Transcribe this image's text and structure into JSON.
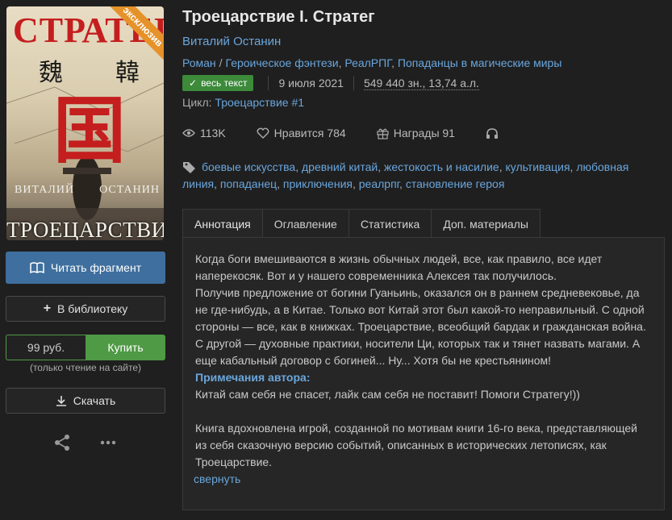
{
  "cover": {
    "title_top": "СТРАТЕГ",
    "badge": "эксклюзив",
    "author_first": "ВИТАЛИЙ",
    "author_last": "ОСТАНИН",
    "title_bottom": "ТРОЕЦАРСТВИЕ",
    "glyph_left": "魏",
    "glyph_right": "韓",
    "glyph_center": "国"
  },
  "actions": {
    "read_fragment": "Читать фрагмент",
    "add_library": "В библиотеку",
    "price": "99 руб.",
    "buy": "Купить",
    "buy_note": "(только чтение на сайте)",
    "download": "Скачать"
  },
  "book": {
    "title": "Троецарствие I. Стратег",
    "author": "Виталий Останин",
    "genres": [
      "Роман",
      "Героическое фэнтези",
      "РеалРПГ",
      "Попаданцы в магические миры"
    ],
    "full_text_badge": "весь текст",
    "date": "9 июля 2021",
    "size": "549 440 зн., 13,74 а.л.",
    "cycle_label": "Цикл:",
    "cycle_value": "Троецарствие #1"
  },
  "stats": {
    "views": "113K",
    "likes": "Нравится 784",
    "awards": "Награды 91"
  },
  "tags": [
    "боевые искусства",
    "древний китай",
    "жестокость и насилие",
    "культивация",
    "любовная линия",
    "попаданец",
    "приключения",
    "реалрпг",
    "становление героя"
  ],
  "tabs": [
    "Аннотация",
    "Оглавление",
    "Статистика",
    "Доп. материалы"
  ],
  "annotation": {
    "p1": "Когда боги вмешиваются в жизнь обычных людей, все, как правило, все идет наперекосяк. Вот и у нашего современника Алексея так получилось.",
    "p2": "Получив предложение от богини Гуаньинь, оказался он в раннем средневековье, да не где-нибудь, а в Китае. Только вот Китай этот был какой-то неправильный. С одной стороны — все, как в книжках. Троецарствие, всеобщий бардак и гражданская война. С другой — духовные практики, носители Ци, которых так и тянет назвать магами. А еще кабальный договор с богиней... Ну... Хотя бы не крестьянином!",
    "notes_title": "Примечания автора:",
    "notes_text": "Китай сам себя не спасет, лайк сам себя не поставит! Помоги Стратегу!))",
    "p3": "Книга вдохновлена игрой, созданной по мотивам книги 16-го века, представляющей из себя сказочную версию событий, описанных в исторических летописях, как Троецарствие.",
    "collapse": "свернуть"
  }
}
